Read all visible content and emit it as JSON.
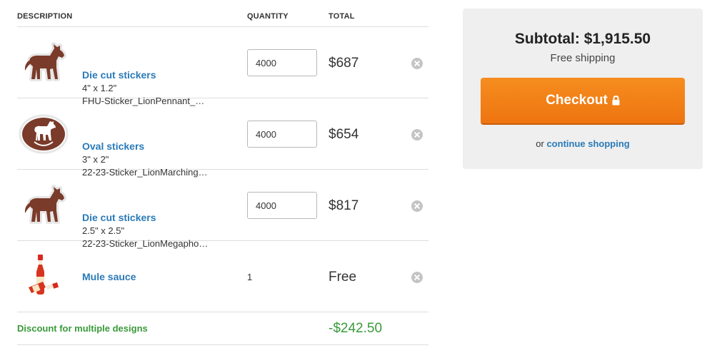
{
  "headers": {
    "description": "DESCRIPTION",
    "quantity": "QUANTITY",
    "total": "TOTAL"
  },
  "items": [
    {
      "name": "Die cut stickers",
      "size": "4\" x 1.2\"",
      "file": "FHU-Sticker_LionPennant_…",
      "quantity": "4000",
      "price": "$687",
      "thumb_icon": "mule-die-cut-sticker-icon"
    },
    {
      "name": "Oval stickers",
      "size": "3\" x 2\"",
      "file": "22-23-Sticker_LionMarching…",
      "quantity": "4000",
      "price": "$654",
      "thumb_icon": "mule-oval-sticker-icon"
    },
    {
      "name": "Die cut stickers",
      "size": "2.5\" x 2.5\"",
      "file": "22-23-Sticker_LionMegapho…",
      "quantity": "4000",
      "price": "$817",
      "thumb_icon": "mule-die-cut-sticker-icon"
    },
    {
      "name": "Mule sauce",
      "quantity": "1",
      "price": "Free",
      "thumb_icon": "hot-sauce-bottle-icon"
    }
  ],
  "discount": {
    "label": "Discount for multiple designs",
    "value": "-$242.50"
  },
  "summary": {
    "subtotal": "Subtotal: $1,915.50",
    "shipping": "Free shipping",
    "checkout_label": "Checkout",
    "continue_prefix": "or",
    "continue_link": "continue shopping"
  },
  "colors": {
    "link": "#2a7ab8",
    "discount": "#3a9a3a",
    "checkout": "#f0791a",
    "sticker_brown": "#7a3b2a",
    "summary_bg": "#efefef"
  }
}
